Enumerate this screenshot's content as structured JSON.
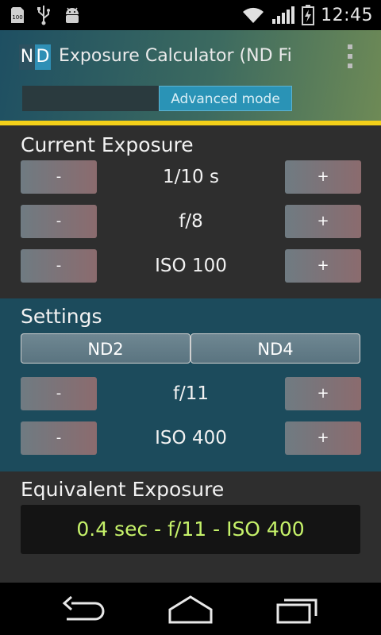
{
  "status_bar": {
    "time": "12:45",
    "icons": [
      "storage-100-icon",
      "usb-icon",
      "android-debug-icon",
      "wifi-icon",
      "signal-icon",
      "battery-charging-icon"
    ],
    "storage_badge": "100"
  },
  "action_bar": {
    "logo_left": "N",
    "logo_right": "D",
    "title": "Exposure Calculator (ND Fi",
    "mode_button": "Advanced mode",
    "accent_color": "#f3d019"
  },
  "current": {
    "heading": "Current Exposure",
    "rows": [
      {
        "minus": "-",
        "value": "1/10 s",
        "plus": "+"
      },
      {
        "minus": "-",
        "value": "f/8",
        "plus": "+"
      },
      {
        "minus": "-",
        "value": "ISO 100",
        "plus": "+"
      }
    ]
  },
  "settings": {
    "heading": "Settings",
    "nd_buttons": [
      "ND2",
      "ND4"
    ],
    "rows": [
      {
        "minus": "-",
        "value": "f/11",
        "plus": "+"
      },
      {
        "minus": "-",
        "value": "ISO 400",
        "plus": "+"
      }
    ]
  },
  "equivalent": {
    "heading": "Equivalent Exposure",
    "result": "0.4 sec - f/11 - ISO 400",
    "result_color": "#c6f26a"
  },
  "nav_bar": {
    "icons": [
      "back-icon",
      "home-icon",
      "recents-icon"
    ]
  }
}
